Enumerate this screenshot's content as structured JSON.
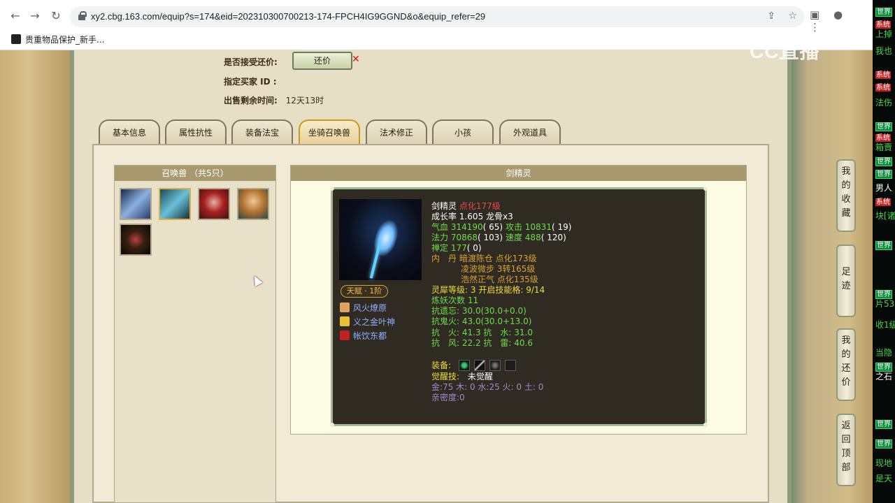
{
  "browser": {
    "url": "xy2.cbg.163.com/equip?s=174&eid=202310300700213-174-FPCH4IG9GGND&o&equip_refer=29",
    "bookmark_label": "贵重物品保护_新手..."
  },
  "sale": {
    "accept_counter_label": "是否接受还价:",
    "counter_button": "还价",
    "buyer_id_label": "指定买家 ID :",
    "remaining_label": "出售剩余时间:",
    "remaining_value": "12天13时"
  },
  "tabs": [
    "基本信息",
    "属性抗性",
    "装备法宝",
    "坐骑召唤兽",
    "法术修正",
    "小孩",
    "外观道具"
  ],
  "active_tab_index": 3,
  "pet_list": {
    "header": "召唤兽 （共5只）",
    "count": 5,
    "selected_index": 1
  },
  "pet": {
    "header": "剑精灵",
    "name": "剑精灵",
    "tier": "点化177级",
    "growth_label": "成长率",
    "growth": "1.605",
    "dragon_bone": "龙骨x3",
    "hp_label": "气血",
    "hp": "314190",
    "hp_pts": "( 65)",
    "atk_label": "攻击",
    "atk": "10831",
    "atk_pts": "( 19)",
    "mp_label": "法力",
    "mp": "70868",
    "mp_pts": "( 103)",
    "spd_label": "速度",
    "spd": "488",
    "spd_pts": "( 120)",
    "zen_label": "禅定",
    "zen": "177",
    "zen_pts": "( 0)",
    "inner_label": "内　丹",
    "inner1_name": "暗渡陈仓",
    "inner1_level": "点化173级",
    "inner2_name": "凌波微步",
    "inner2_level": "3转165级",
    "inner3_name": "浩然正气",
    "inner3_level": "点化135级",
    "talent": "天赋 · 1阶",
    "skills": [
      "风火燎原",
      "义之金叶神",
      "帐饮东都"
    ],
    "lingxi_label": "灵犀等级:",
    "lingxi": "3",
    "skill_open_label": "开启技能格:",
    "skill_open": "9/14",
    "refine_label": "炼妖次数",
    "refine": "11",
    "res1_label": "抗遗忘:",
    "res1_val": "30.0(30.0+0.0)",
    "res2_label": "抗鬼火:",
    "res2_val": "43.0(30.0+13.0)",
    "res3": "抗　火: 41.3 抗　水: 31.0",
    "res4": "抗　风: 22.2 抗　雷: 40.6",
    "equip_label": "装备:",
    "awaken_label": "觉醒技:",
    "awaken_value": "未觉醒",
    "elements": "金:75 木: 0 水:25 火: 0 土: 0",
    "intimacy": "亲密度:0"
  },
  "side_buttons": [
    "我的收藏",
    "足迹",
    "我的还价",
    "返回顶部"
  ],
  "overlay_logo": "CC直播",
  "chat_lines": [
    "世界",
    "系统",
    "上掉",
    "我也",
    "系统",
    "系统",
    "法伤",
    "世界",
    "系统",
    "箱賣",
    "世界",
    "世界",
    "男人",
    "系统",
    "块[诸",
    "世界",
    "世界",
    "片53",
    "收1级",
    "当隐",
    "世界",
    "之石",
    "世界",
    "世界",
    "现地",
    "是天"
  ]
}
